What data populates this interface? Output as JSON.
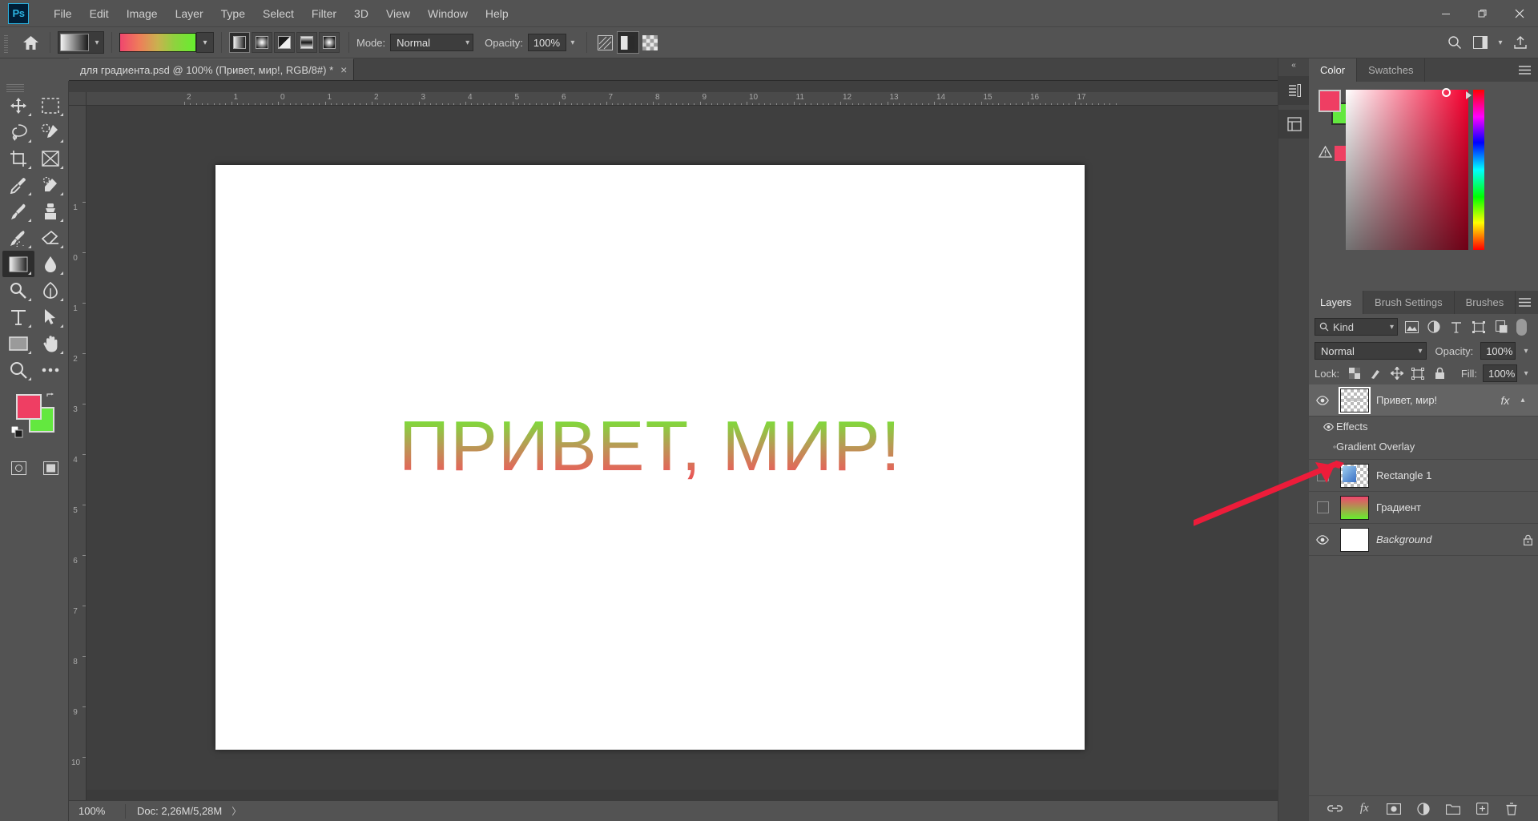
{
  "app": {
    "logo": "Ps",
    "menus": [
      "File",
      "Edit",
      "Image",
      "Layer",
      "Type",
      "Select",
      "Filter",
      "3D",
      "View",
      "Window",
      "Help"
    ],
    "window_controls": [
      "minimize-icon",
      "restore-icon",
      "close-icon"
    ]
  },
  "options_bar": {
    "home_icon": "home-icon",
    "gradient_picker_icon": "gradient-preset-icon",
    "gradient_preview": "linear-gradient-pink-green",
    "gradient_types": [
      "linear-gradient-icon",
      "radial-gradient-icon",
      "angle-gradient-icon",
      "reflected-gradient-icon",
      "diamond-gradient-icon"
    ],
    "gradient_type_active_index": 0,
    "mode_label": "Mode:",
    "mode_value": "Normal",
    "opacity_label": "Opacity:",
    "opacity_value": "100%",
    "dither_icon": "dither-icon",
    "reverse_icon": "reverse-icon",
    "transparency_icon": "transparency-icon",
    "right_icons": [
      "search-icon",
      "workspace-icon",
      "chevron-down-icon",
      "share-icon"
    ]
  },
  "document": {
    "tab_title": "для градиента.psd @ 100% (Привет, мир!, RGB/8#) *",
    "tab_close": "×",
    "canvas_text": "ПРИВЕТ, МИР!",
    "canvas_text_gradient_top": "#62ee30",
    "canvas_text_gradient_bottom": "#e8434c"
  },
  "rulers": {
    "horizontal_ticks": [
      "2",
      "1",
      "0",
      "1",
      "2",
      "3",
      "4",
      "5",
      "6",
      "7",
      "8",
      "9",
      "10",
      "11",
      "12",
      "13",
      "14",
      "15",
      "16",
      "17"
    ],
    "vertical_ticks": [
      "1",
      "0",
      "1",
      "2",
      "3",
      "4",
      "5",
      "6",
      "7",
      "8",
      "9",
      "10"
    ]
  },
  "toolbar": {
    "tools": [
      {
        "name": "move-tool",
        "icon": "move-icon"
      },
      {
        "name": "marquee-tool",
        "icon": "rectangular-marquee-icon"
      },
      {
        "name": "lasso-tool",
        "icon": "lasso-icon"
      },
      {
        "name": "quick-selection-tool",
        "icon": "quick-selection-icon"
      },
      {
        "name": "crop-tool",
        "icon": "crop-icon"
      },
      {
        "name": "frame-tool",
        "icon": "frame-icon"
      },
      {
        "name": "eyedropper-tool",
        "icon": "eyedropper-icon"
      },
      {
        "name": "healing-brush-tool",
        "icon": "healing-brush-icon"
      },
      {
        "name": "brush-tool",
        "icon": "brush-icon"
      },
      {
        "name": "clone-stamp-tool",
        "icon": "clone-stamp-icon"
      },
      {
        "name": "history-brush-tool",
        "icon": "history-brush-icon"
      },
      {
        "name": "eraser-tool",
        "icon": "eraser-icon"
      },
      {
        "name": "gradient-tool",
        "icon": "gradient-icon"
      },
      {
        "name": "blur-tool",
        "icon": "blur-icon"
      },
      {
        "name": "dodge-tool",
        "icon": "dodge-icon"
      },
      {
        "name": "pen-tool",
        "icon": "pen-icon"
      },
      {
        "name": "type-tool",
        "icon": "type-icon"
      },
      {
        "name": "path-selection-tool",
        "icon": "path-selection-icon"
      },
      {
        "name": "rectangle-tool",
        "icon": "rectangle-icon"
      },
      {
        "name": "hand-tool",
        "icon": "hand-icon"
      },
      {
        "name": "zoom-tool",
        "icon": "zoom-icon"
      },
      {
        "name": "edit-toolbar",
        "icon": "ellipsis-icon"
      }
    ],
    "active_tool_index": 12,
    "foreground_color": "#ef3e63",
    "background_color": "#63e83f",
    "swap_icon": "swap-colors-icon",
    "default_icon": "default-colors-icon",
    "quick_mask_icon": "quick-mask-icon",
    "screen_mode_icon": "screen-mode-icon"
  },
  "status_bar": {
    "zoom": "100%",
    "doc_label": "Doc:",
    "doc_value": "2,26M/5,28M",
    "expand_icon": "〉"
  },
  "dock_strip": {
    "collapse_icon": "«",
    "icons": [
      "history-panel-icon",
      "properties-panel-icon"
    ]
  },
  "color_panel": {
    "tabs": [
      {
        "label": "Color",
        "active": true
      },
      {
        "label": "Swatches",
        "active": false
      }
    ],
    "menu_icon": "panel-menu-icon",
    "foreground": "#ef3e63",
    "background": "#63e83f",
    "warning_icon": "out-of-gamut-warning-icon",
    "warning_swatch": "#ef4062"
  },
  "layers_panel": {
    "tabs": [
      {
        "label": "Layers",
        "active": true
      },
      {
        "label": "Brush Settings",
        "active": false
      },
      {
        "label": "Brushes",
        "active": false
      }
    ],
    "menu_icon": "panel-menu-icon",
    "filter_kind_label": "Kind",
    "filter_search_icon": "search-icon",
    "filter_icons": [
      "pixel-filter-icon",
      "adjustment-filter-icon",
      "type-filter-icon",
      "shape-filter-icon",
      "smartobject-filter-icon"
    ],
    "filter_toggle": "filter-enable-toggle",
    "blend_mode": "Normal",
    "opacity_label": "Opacity:",
    "opacity_value": "100%",
    "lock_label": "Lock:",
    "lock_icons": [
      "lock-transparent-pixels-icon",
      "lock-image-pixels-icon",
      "lock-position-icon",
      "lock-artboard-icon",
      "lock-all-icon"
    ],
    "fill_label": "Fill:",
    "fill_value": "100%",
    "layers": [
      {
        "name": "Привет, мир!",
        "visible": true,
        "selected": true,
        "thumb_type": "transparent-text",
        "has_fx": true,
        "fx_label": "fx",
        "chevron": "⌃",
        "locked": false,
        "italic": false
      },
      {
        "name": "Rectangle 1",
        "visible": false,
        "selected": false,
        "thumb_type": "shape-blue",
        "has_fx": false,
        "locked": false,
        "italic": false
      },
      {
        "name": "Градиент",
        "visible": false,
        "selected": false,
        "thumb_type": "gradient-pink-green",
        "has_fx": false,
        "locked": false,
        "italic": false
      },
      {
        "name": "Background",
        "visible": true,
        "selected": false,
        "thumb_type": "white",
        "has_fx": false,
        "locked": true,
        "lock_icon": "lock-icon",
        "italic": true
      }
    ],
    "effects_group": {
      "label": "Effects",
      "visible": true,
      "children": [
        {
          "label": "Gradient Overlay",
          "visible": true
        }
      ]
    },
    "bottom_icons": [
      "link-layers-icon",
      "add-layer-style-icon",
      "add-layer-mask-icon",
      "new-adjustment-layer-icon",
      "new-group-icon",
      "new-layer-icon",
      "delete-layer-icon"
    ]
  },
  "annotation": {
    "arrow_color": "#ed1c3a",
    "arrow_name": "red-pointer-arrow"
  }
}
